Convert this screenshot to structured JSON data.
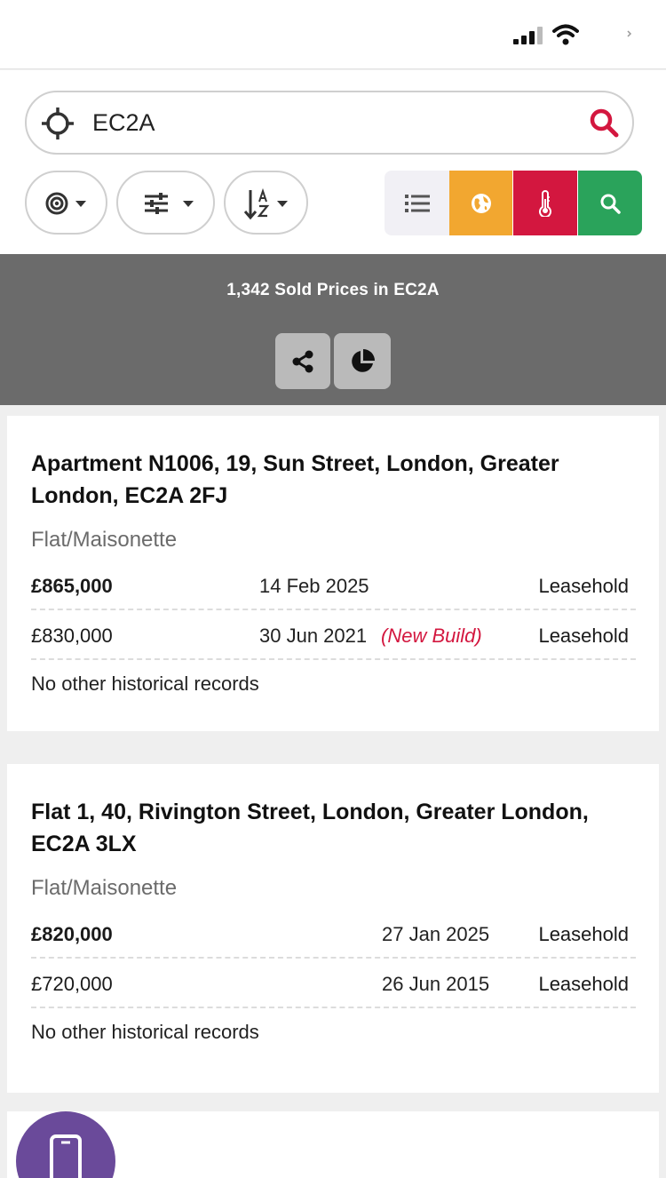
{
  "status_bar": {
    "icons": [
      "cellular-signal-icon",
      "wifi-icon",
      "battery-icon"
    ]
  },
  "search": {
    "value": "EC2A",
    "icons": [
      "crosshair-locate-icon",
      "search-icon"
    ],
    "accent_color": "#d3173f"
  },
  "filters": {
    "buttons": [
      "radius-icon",
      "sliders-icon",
      "sort-az-icon"
    ]
  },
  "view_toggle": {
    "buttons": [
      {
        "icon": "list-icon",
        "color": "#f1f0f5"
      },
      {
        "icon": "globe-icon",
        "color": "#f2a730"
      },
      {
        "icon": "thermometer-icon",
        "color": "#d3173f"
      },
      {
        "icon": "search-icon",
        "color": "#2aa35b"
      }
    ]
  },
  "results": {
    "title": "1,342 Sold Prices in EC2A",
    "actions": [
      "share-icon",
      "pie-chart-icon"
    ]
  },
  "listings": [
    {
      "address": "Apartment N1006, 19, Sun Street, London, Greater London, EC2A 2FJ",
      "type": "Flat/Maisonette",
      "sales": [
        {
          "price": "£865,000",
          "date": "14 Feb 2025",
          "note": "",
          "tenure": "Leasehold"
        },
        {
          "price": "£830,000",
          "date": "30 Jun 2021",
          "note": "(New Build)",
          "tenure": "Leasehold"
        }
      ],
      "footer": "No other historical records"
    },
    {
      "address": "Flat 1, 40, Rivington Street, London, Greater London, EC2A 3LX",
      "type": "Flat/Maisonette",
      "sales": [
        {
          "price": "£820,000",
          "date": "27 Jan 2025",
          "note": "",
          "tenure": "Leasehold"
        },
        {
          "price": "£720,000",
          "date": "26 Jun 2015",
          "note": "",
          "tenure": "Leasehold"
        }
      ],
      "footer": "No other historical records"
    }
  ],
  "fab": {
    "icon": "mobile-phone-icon",
    "color": "#6a4a9a"
  }
}
